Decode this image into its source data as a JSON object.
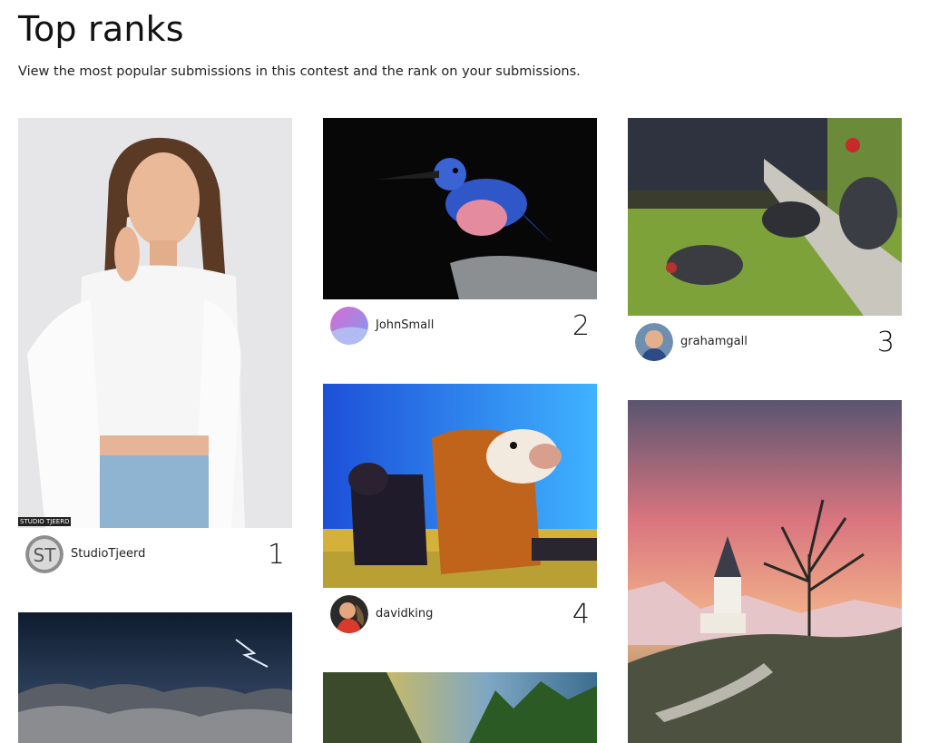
{
  "page": {
    "title": "Top ranks",
    "description": "View the most popular submissions in this contest and the rank on your submissions."
  },
  "submissions": [
    {
      "username": "StudioTjeerd",
      "rank": "1",
      "avatar_text": "ST",
      "watermark": "STUDIO TJEERD"
    },
    {
      "username": "JohnSmall",
      "rank": "2"
    },
    {
      "username": "grahamgall",
      "rank": "3"
    },
    {
      "username": "davidking",
      "rank": "4"
    }
  ],
  "colors": {
    "accent_avatar_johnsmall": "#d86ad0",
    "text": "#111111",
    "background": "#ffffff"
  }
}
